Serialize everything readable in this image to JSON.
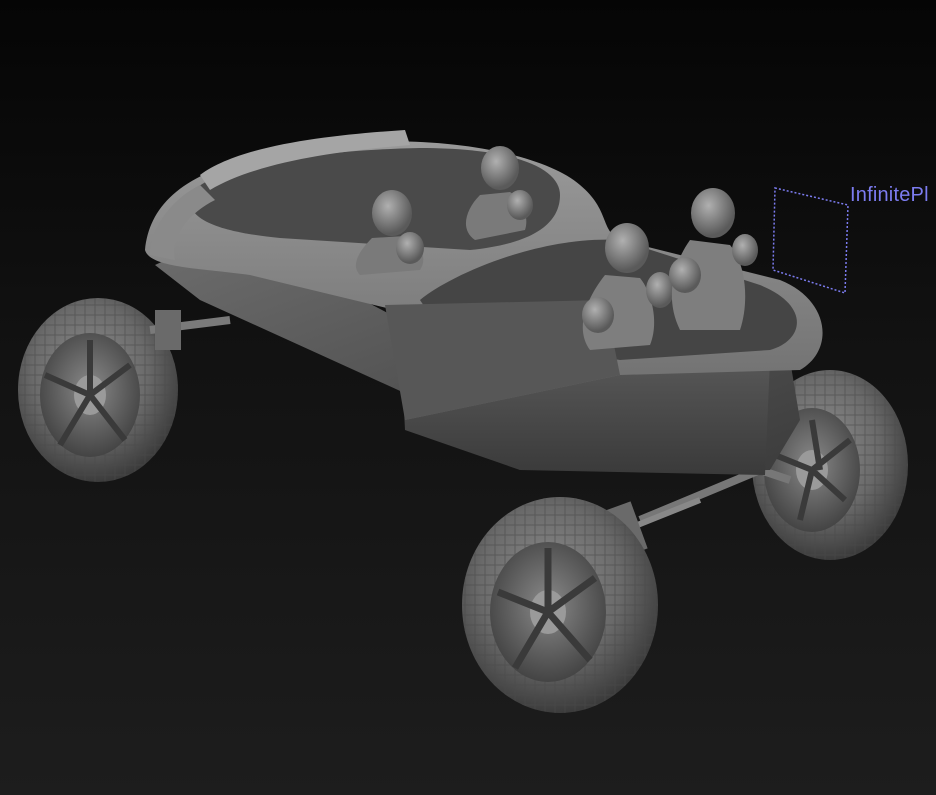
{
  "viewport": {
    "background_top": "#050505",
    "background_bottom": "#1d1d1d"
  },
  "model": {
    "name": "buggy-with-four-occupants",
    "base_color": "#6a6a6a",
    "occupants": 4,
    "wheels": 4
  },
  "plane": {
    "label": "InfinitePl",
    "color": "#7c7cf0"
  }
}
